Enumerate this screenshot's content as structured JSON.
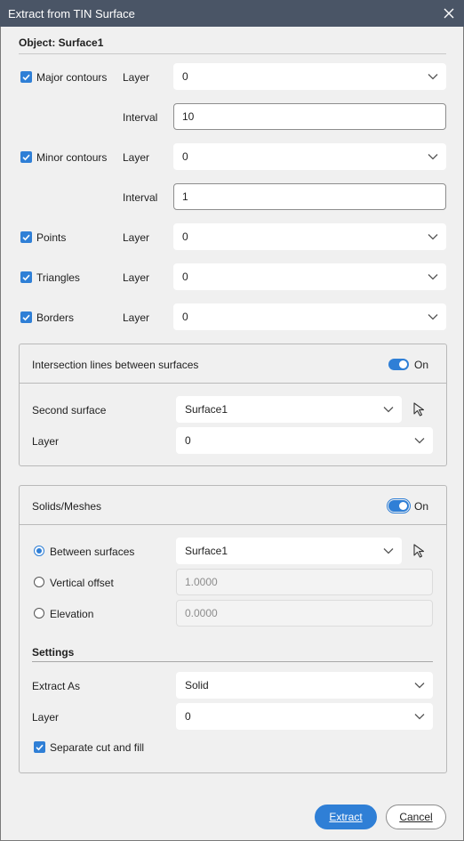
{
  "window": {
    "title": "Extract from TIN Surface"
  },
  "object": {
    "label": "Object: Surface1"
  },
  "rows": {
    "major": {
      "label": "Major contours",
      "checked": true,
      "layer_label": "Layer",
      "layer_value": "0",
      "interval_label": "Interval",
      "interval_value": "10"
    },
    "minor": {
      "label": "Minor contours",
      "checked": true,
      "layer_label": "Layer",
      "layer_value": "0",
      "interval_label": "Interval",
      "interval_value": "1"
    },
    "points": {
      "label": "Points",
      "checked": true,
      "layer_label": "Layer",
      "layer_value": "0"
    },
    "triangles": {
      "label": "Triangles",
      "checked": true,
      "layer_label": "Layer",
      "layer_value": "0"
    },
    "borders": {
      "label": "Borders",
      "checked": true,
      "layer_label": "Layer",
      "layer_value": "0"
    }
  },
  "intersection": {
    "title": "Intersection lines between surfaces",
    "toggle_label": "On",
    "second_surface_label": "Second surface",
    "second_surface_value": "Surface1",
    "layer_label": "Layer",
    "layer_value": "0"
  },
  "solids": {
    "title": "Solids/Meshes",
    "toggle_label": "On",
    "between_label": "Between surfaces",
    "between_value": "Surface1",
    "vertical_label": "Vertical offset",
    "vertical_value": "1.0000",
    "elevation_label": "Elevation",
    "elevation_value": "0.0000",
    "selected_option": "Between surfaces",
    "settings_title": "Settings",
    "extract_as_label": "Extract As",
    "extract_as_value": "Solid",
    "layer_label": "Layer",
    "layer_value": "0",
    "separate_label": "Separate cut and fill",
    "separate_checked": true
  },
  "buttons": {
    "extract": "Extract",
    "cancel": "Cancel"
  },
  "colors": {
    "accent": "#2f7fd6",
    "titlebar": "#4a5566",
    "background": "#f0f0f0"
  }
}
